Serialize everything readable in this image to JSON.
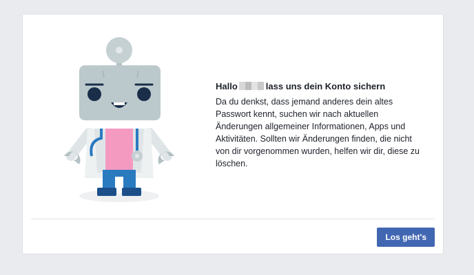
{
  "dialog": {
    "title_greeting": "Hallo",
    "title_rest": "lass uns dein Konto sichern",
    "body": "Da du denkst, dass jemand anderes dein altes Passwort kennt, suchen wir nach aktuellen Änderungen allgemeiner Informationen, Apps und Aktivitäten. Sollten wir Änderungen finden, die nicht von dir vorgenommen wurden, helfen wir dir, diese zu löschen.",
    "button_label": "Los geht's"
  },
  "colors": {
    "page_background": "#e9ebee",
    "button": "#4267b2",
    "robot_head": "#bcc9cc",
    "robot_shirt": "#f49ac1",
    "robot_pants": "#2a7ac0"
  },
  "illustration": {
    "icon": "doctor-robot-icon"
  }
}
